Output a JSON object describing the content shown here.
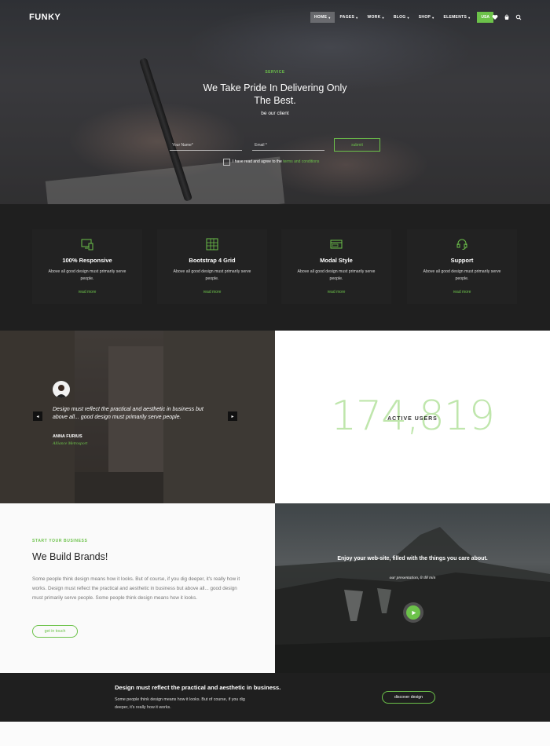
{
  "header": {
    "logo": "FUNKY",
    "nav": [
      {
        "label": "HOME",
        "active": true
      },
      {
        "label": "PAGES"
      },
      {
        "label": "WORK"
      },
      {
        "label": "BLOG"
      },
      {
        "label": "SHOP"
      },
      {
        "label": "ELEMENTS"
      }
    ],
    "nav_cta": "USA",
    "icons": [
      "heart-icon",
      "bag-icon",
      "search-icon"
    ]
  },
  "hero": {
    "eyebrow": "SERVICE",
    "title": "We Take Pride In Delivering Only The Best.",
    "subtitle": "be our client",
    "name_placeholder": "Your Name*",
    "email_placeholder": "Email *",
    "submit_label": "submit",
    "terms_text": "I have read and agree to the",
    "terms_link": "terms and conditions"
  },
  "features": [
    {
      "icon": "monitor-mobile-icon",
      "title": "100% Responsive",
      "text": "Above all good design must primarily serve people.",
      "link": "read more"
    },
    {
      "icon": "grid-icon",
      "title": "Bootstrap 4 Grid",
      "text": "Above all good design must primarily serve people.",
      "link": "read more"
    },
    {
      "icon": "window-icon",
      "title": "Modal Style",
      "text": "Above all good design must primarily serve people.",
      "link": "read more"
    },
    {
      "icon": "headset-icon",
      "title": "Support",
      "text": "Above all good design must primarily serve people.",
      "link": "read more"
    }
  ],
  "testimonial": {
    "quote": "Design must reflect the practical and aesthetic in business but above all... good design must primarily serve people.",
    "name": "ANNA FURIUS",
    "company": "Alliance Metrosport"
  },
  "stats": {
    "number": "174,819",
    "label": "ACTIVE USERS"
  },
  "brands": {
    "eyebrow": "START YOUR BUSINESS",
    "title": "We Build Brands!",
    "text": "Some people think design means how it looks. But of course, if you dig deeper, it's really how it works. Design must reflect the practical and aesthetic in business but above all... good design must primarily serve people. Some people think design means how it looks.",
    "button": "get in touch"
  },
  "video": {
    "title": "Enjoy your web-site, filled with the things you care about.",
    "subtitle": "our presentation, 0:48 min"
  },
  "cta": {
    "title": "Design must reflect the practical and aesthetic in business.",
    "text": "Some people think design means how it looks. But of course, if you dig deeper, it's really how it works.",
    "button": "discover design"
  },
  "colors": {
    "accent": "#6cc24a",
    "dark": "#1f1f1f"
  }
}
